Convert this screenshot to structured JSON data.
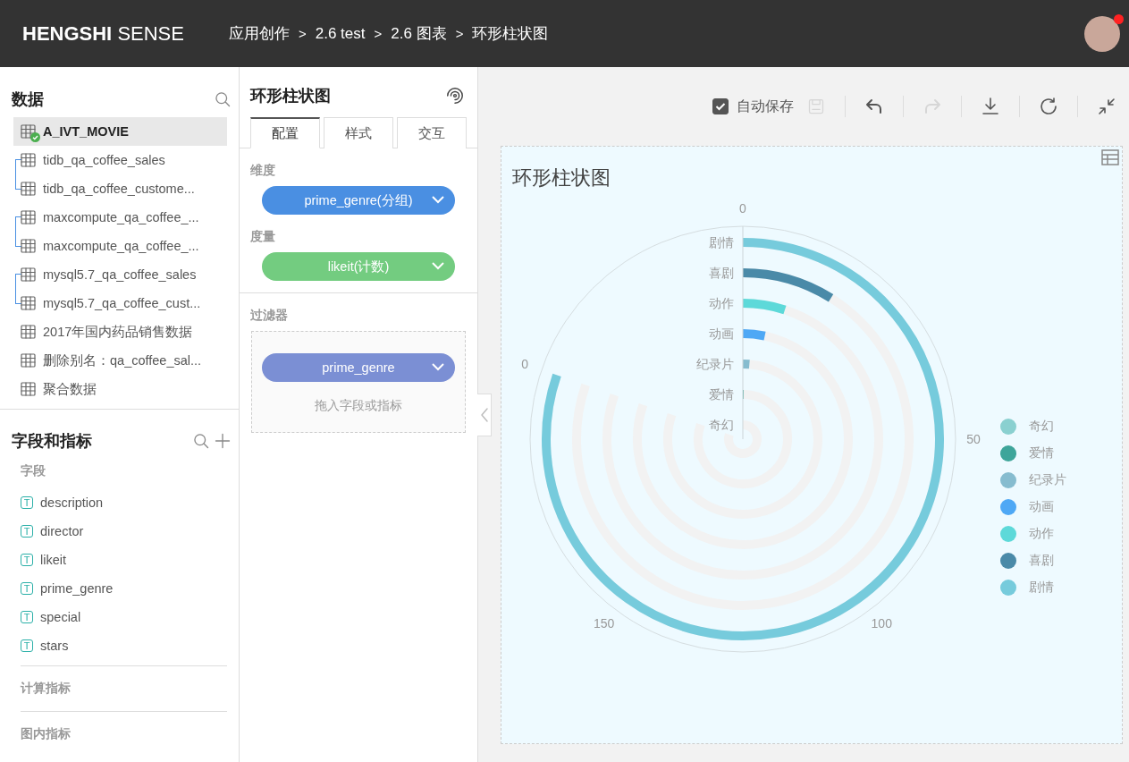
{
  "header": {
    "brand_bold": "HENGSHI",
    "brand_light": "SENSE",
    "breadcrumb": [
      "应用创作",
      "2.6 test",
      "2.6 图表",
      "环形柱状图"
    ],
    "separator": ">",
    "notification": true
  },
  "data_panel": {
    "title": "数据",
    "items": [
      {
        "kind": "single",
        "label": "A_IVT_MOVIE",
        "selected": true,
        "linked": true
      },
      {
        "kind": "pair",
        "children": [
          {
            "label": "tidb_qa_coffee_sales",
            "selected": false
          },
          {
            "label": "tidb_qa_coffee_custome...",
            "selected": false
          }
        ]
      },
      {
        "kind": "pair",
        "children": [
          {
            "label": "maxcompute_qa_coffee_...",
            "selected": false
          },
          {
            "label": "maxcompute_qa_coffee_...",
            "selected": false
          }
        ]
      },
      {
        "kind": "pair",
        "children": [
          {
            "label": "mysql5.7_qa_coffee_sales",
            "selected": false
          },
          {
            "label": "mysql5.7_qa_coffee_cust...",
            "selected": false
          }
        ]
      },
      {
        "kind": "single",
        "label": "2017年国内药品销售数据",
        "selected": false,
        "linked": false
      },
      {
        "kind": "single",
        "label": "删除别名：qa_coffee_sal...",
        "selected": false,
        "linked": false
      },
      {
        "kind": "single",
        "label": "聚合数据",
        "selected": false,
        "linked": false
      }
    ]
  },
  "fields_panel": {
    "title": "字段和指标",
    "sections": [
      {
        "title": "字段",
        "fields": [
          {
            "label": "description",
            "type_icon": "T"
          },
          {
            "label": "director",
            "type_icon": "T"
          },
          {
            "label": "likeit",
            "type_icon": "T"
          },
          {
            "label": "prime_genre",
            "type_icon": "T"
          },
          {
            "label": "special",
            "type_icon": "T"
          },
          {
            "label": "stars",
            "type_icon": "T"
          }
        ]
      },
      {
        "title": "计算指标"
      },
      {
        "title": "图内指标"
      }
    ]
  },
  "config_panel": {
    "title": "环形柱状图",
    "tabs": [
      {
        "label": "配置",
        "selected": true
      },
      {
        "label": "样式",
        "selected": false
      },
      {
        "label": "交互",
        "selected": false
      }
    ],
    "sections": [
      {
        "title": "维度",
        "pills": [
          {
            "label": "prime_genre(分组)",
            "kind": "dimension"
          }
        ]
      },
      {
        "title": "度量",
        "pills": [
          {
            "label": "likeit(计数)",
            "kind": "measure"
          }
        ]
      }
    ],
    "filter": {
      "title": "过滤器",
      "pills": [
        {
          "label": "prime_genre",
          "kind": "filter"
        }
      ],
      "placeholder": "拖入字段或指标"
    }
  },
  "toolbar": {
    "autosave": {
      "label": "自动保存",
      "checked": true
    },
    "buttons": [
      {
        "kind": "save",
        "disabled": true
      },
      {
        "kind": "undo",
        "disabled": false
      },
      {
        "kind": "redo",
        "disabled": true
      },
      {
        "kind": "download",
        "disabled": false
      },
      {
        "kind": "refresh",
        "disabled": false
      },
      {
        "kind": "collapse",
        "disabled": false
      }
    ]
  },
  "chart_card": {
    "title": "环形柱状图",
    "ring_labels": [
      "剧情",
      "喜剧",
      "动作",
      "动画",
      "纪录片",
      "爱情",
      "奇幻"
    ],
    "angle_labels": [
      "0",
      "50",
      "100",
      "150",
      "0"
    ],
    "legend": [
      {
        "label": "奇幻",
        "color": "#8ad0d0"
      },
      {
        "label": "爱情",
        "color": "#3ea59a"
      },
      {
        "label": "纪录片",
        "color": "#86bccf"
      },
      {
        "label": "动画",
        "color": "#4ea8f5"
      },
      {
        "label": "动作",
        "color": "#5dd9d9"
      },
      {
        "label": "喜剧",
        "color": "#4a8aa8"
      },
      {
        "label": "剧情",
        "color": "#76cbdc"
      }
    ]
  }
}
